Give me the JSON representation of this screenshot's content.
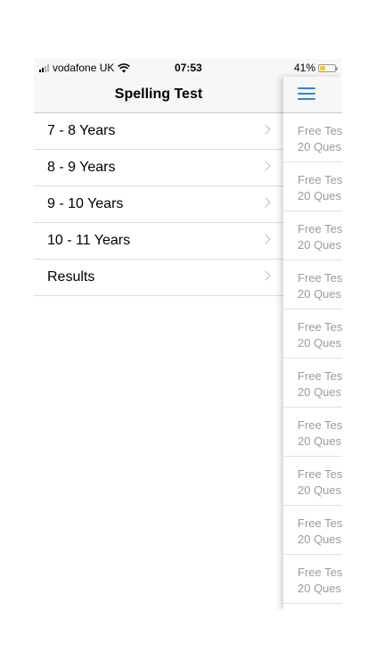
{
  "status_bar": {
    "carrier": "vodafone UK",
    "time": "07:53",
    "battery_percent": "41%",
    "battery_level": 0.41
  },
  "menu": {
    "title": "Spelling Test",
    "items": [
      {
        "label": "7 - 8 Years"
      },
      {
        "label": "8 - 9 Years"
      },
      {
        "label": "9 - 10 Years"
      },
      {
        "label": "10 - 11 Years"
      },
      {
        "label": "Results"
      }
    ]
  },
  "panel": {
    "items": [
      {
        "line1": "Free Tes",
        "line2": "20 Ques"
      },
      {
        "line1": "Free Tes",
        "line2": "20 Ques"
      },
      {
        "line1": "Free Tes",
        "line2": "20 Ques"
      },
      {
        "line1": "Free Tes",
        "line2": "20 Ques"
      },
      {
        "line1": "Free Tes",
        "line2": "20 Ques"
      },
      {
        "line1": "Free Tes",
        "line2": "20 Ques"
      },
      {
        "line1": "Free Tes",
        "line2": "20 Ques"
      },
      {
        "line1": "Free Tes",
        "line2": "20 Ques"
      },
      {
        "line1": "Free Tes",
        "line2": "20 Ques"
      },
      {
        "line1": "Free Tes",
        "line2": "20 Ques"
      }
    ]
  },
  "colors": {
    "accent": "#2e86de",
    "battery": "#f7c531",
    "header_bg": "#f7f7f7",
    "muted_text": "#9b9b9b"
  }
}
